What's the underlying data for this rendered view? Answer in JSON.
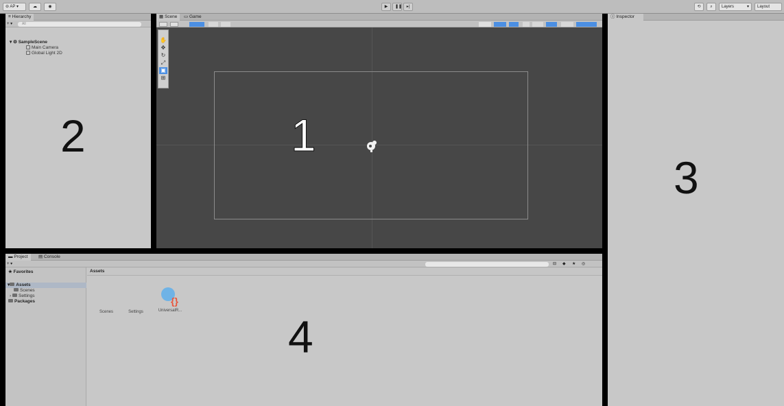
{
  "toolbar": {
    "account_label": "AP",
    "cloud_icon": "cloud-icon",
    "collab_icon": "collab-icon",
    "play_icon": "play-icon",
    "pause_icon": "pause-icon",
    "step_icon": "step-icon",
    "history_icon": "history-icon",
    "search_icon": "search-icon",
    "layers_label": "Layers",
    "layout_label": "Layout"
  },
  "hierarchy": {
    "tab_label": "Hierarchy",
    "search_placeholder": "All",
    "scene_name": "SampleScene",
    "items": [
      "Main Camera",
      "Global Light 2D"
    ],
    "region_number": "2"
  },
  "scene": {
    "tabs": [
      "Scene",
      "Game"
    ],
    "region_number": "1"
  },
  "inspector": {
    "tab_label": "Inspector",
    "region_number": "3"
  },
  "project": {
    "tabs": [
      "Project",
      "Console"
    ],
    "favorites_label": "Favorites",
    "tree": {
      "assets_label": "Assets",
      "assets_children": [
        "Scenes",
        "Settings"
      ],
      "packages_label": "Packages"
    },
    "breadcrumb": "Assets",
    "assets": [
      "Scenes",
      "Settings",
      "UniversalR..."
    ],
    "region_number": "4"
  },
  "colors": {
    "accent_blue": "#4b8fe3",
    "scene_bg": "#474747",
    "panel_bg": "#c8c8c8",
    "frame": "#000000"
  }
}
